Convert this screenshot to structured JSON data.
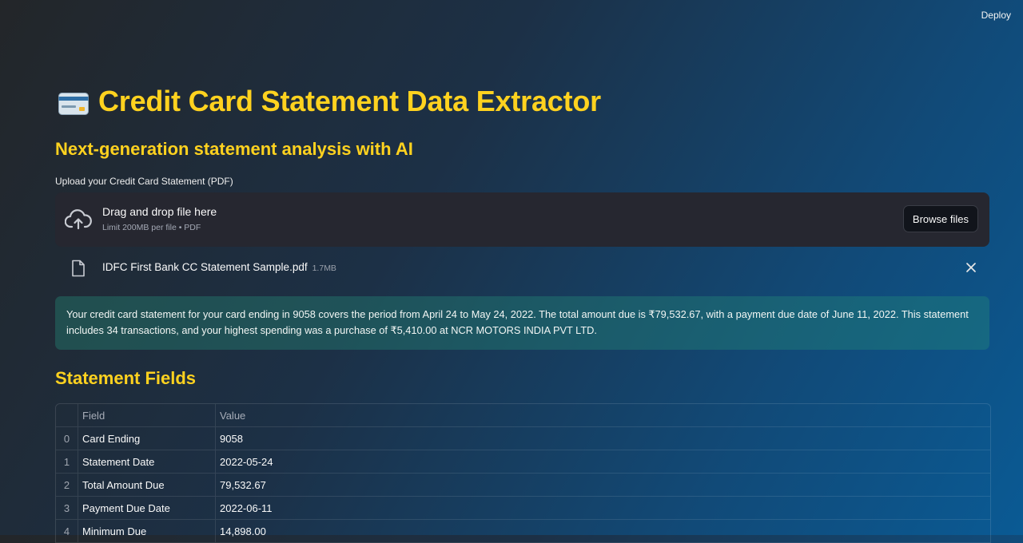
{
  "header": {
    "deploy_label": "Deploy"
  },
  "page": {
    "title": "Credit Card Statement Data Extractor",
    "subtitle": "Next-generation statement analysis with AI"
  },
  "uploader": {
    "label": "Upload your Credit Card Statement (PDF)",
    "drop_text": "Drag and drop file here",
    "limit_text": "Limit 200MB per file • PDF",
    "browse_label": "Browse files",
    "file_name": "IDFC First Bank CC Statement Sample.pdf",
    "file_size": "1.7MB"
  },
  "summary": {
    "text": "Your credit card statement for your card ending in 9058 covers the period from April 24 to May 24, 2022. The total amount due is ₹79,532.67, with a payment due date of June 11, 2022. This statement includes 34 transactions, and your highest spending was a purchase of ₹5,410.00 at NCR MOTORS INDIA PVT LTD."
  },
  "fields_section": {
    "title": "Statement Fields",
    "columns": [
      "",
      "Field",
      "Value"
    ],
    "rows": [
      {
        "index": "0",
        "field": "Card Ending",
        "value": "9058"
      },
      {
        "index": "1",
        "field": "Statement Date",
        "value": "2022-05-24"
      },
      {
        "index": "2",
        "field": "Total Amount Due",
        "value": "79,532.67"
      },
      {
        "index": "3",
        "field": "Payment Due Date",
        "value": "2022-06-11"
      },
      {
        "index": "4",
        "field": "Minimum Due",
        "value": "14,898.00"
      }
    ]
  },
  "colors": {
    "accent_yellow": "#ffd21f",
    "dropzone_bg": "#262730",
    "summary_bg": "#1f6f6a"
  },
  "icons": [
    "credit-card-icon",
    "cloud-upload-icon",
    "file-icon",
    "close-icon"
  ]
}
